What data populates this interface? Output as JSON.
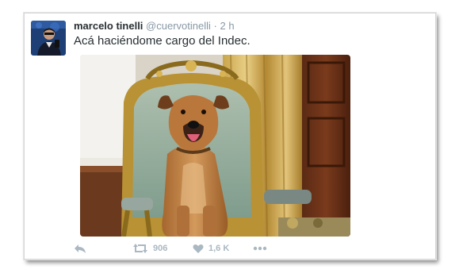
{
  "tweet": {
    "author_name": "marcelo tinelli",
    "author_handle": "@cuervotinelli",
    "separator": "·",
    "timestamp": "2 h",
    "text": "Acá haciéndome cargo del Indec."
  },
  "actions": {
    "reply_icon": "reply-icon",
    "retweet_icon": "retweet-icon",
    "retweet_count": "906",
    "like_icon": "heart-icon",
    "like_count": "1,6 K",
    "more_icon": "more-icon"
  },
  "colors": {
    "text": "#292f33",
    "muted": "#8899a6",
    "action_icons": "#aab8c2"
  }
}
